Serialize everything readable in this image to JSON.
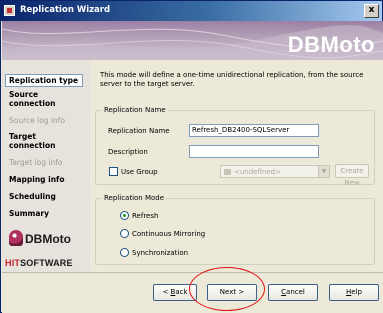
{
  "window": {
    "title": "Replication Wizard",
    "close_glyph": "x"
  },
  "banner": {
    "title": "DBMoto"
  },
  "sidebar": {
    "items": [
      {
        "label": "Replication type",
        "state": "active"
      },
      {
        "label": "Source connection",
        "state": "enabled"
      },
      {
        "label": "Source log info",
        "state": "disabled"
      },
      {
        "label": "Target connection",
        "state": "enabled"
      },
      {
        "label": "Target log info",
        "state": "disabled"
      },
      {
        "label": "Mapping info",
        "state": "enabled"
      },
      {
        "label": "Scheduling",
        "state": "enabled"
      },
      {
        "label": "Summary",
        "state": "enabled"
      }
    ],
    "logo_text": "DBMoto",
    "hit_logo_hit": "HIT",
    "hit_logo_rest": "SOFTWARE"
  },
  "main": {
    "intro_text": "This mode will define a one-time unidirectional replication, from the source server to the target server.",
    "name_group": {
      "legend": "Replication Name",
      "name_label": "Replication Name",
      "name_value": "Refresh_DB2400-SQLServer",
      "description_label": "Description",
      "description_value": "",
      "use_group_label": "Use Group",
      "group_value": "<undefined>",
      "create_new_label": "Create New"
    },
    "mode_group": {
      "legend": "Replication Mode",
      "options": [
        {
          "label": "Refresh",
          "selected": true
        },
        {
          "label": "Continuous Mirroring",
          "selected": false
        },
        {
          "label": "Synchronization",
          "selected": false
        }
      ]
    }
  },
  "buttons": {
    "back_prefix": "< ",
    "back_mnemonic": "B",
    "back_rest": "ack",
    "next_label": "Next >",
    "cancel_mnemonic": "C",
    "cancel_rest": "ancel",
    "help_mnemonic": "H",
    "help_rest": "elp"
  },
  "colors": {
    "titlebar_start": "#0a246a",
    "banner": "#9c80a4",
    "highlight_ellipse": "#e01010"
  }
}
